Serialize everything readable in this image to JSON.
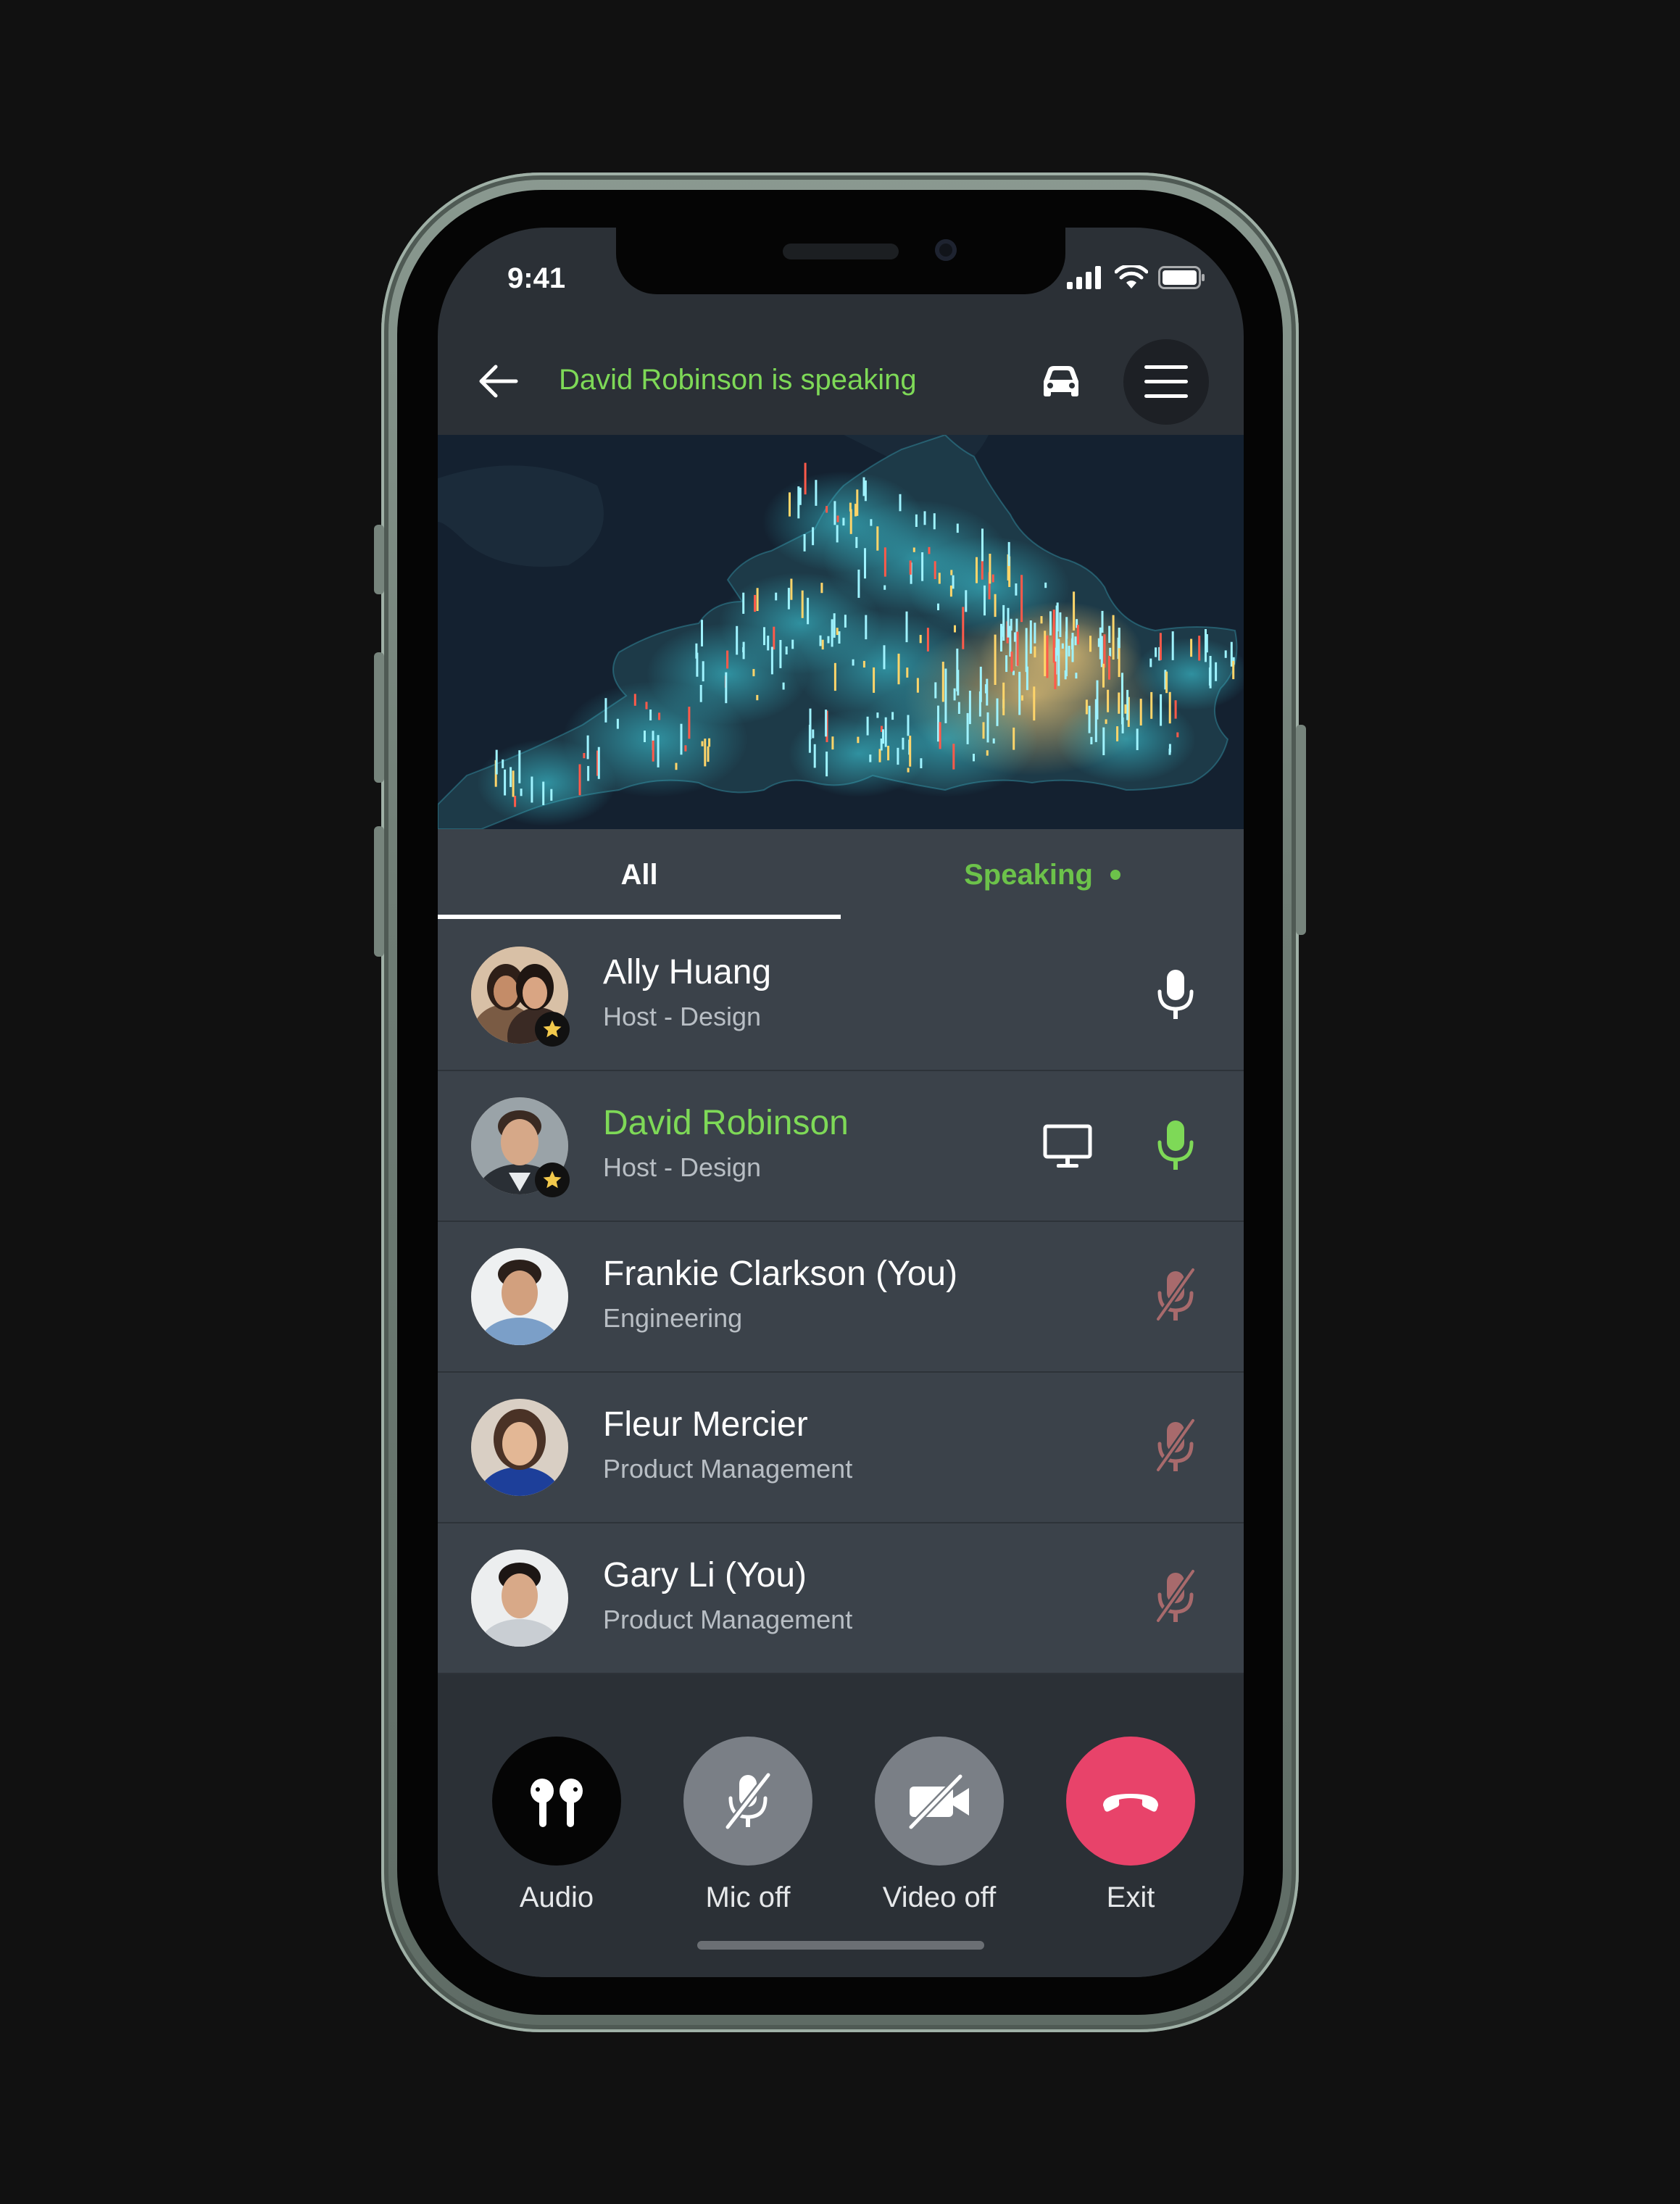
{
  "status_bar": {
    "time": "9:41"
  },
  "header": {
    "title": "David Robinson is speaking"
  },
  "tabs": [
    {
      "label": "All"
    },
    {
      "label": "Speaking"
    }
  ],
  "participants": [
    {
      "name": "Ally Huang",
      "role": "Host - Design",
      "host": true,
      "speaking": false,
      "mic": "on",
      "sharing": false
    },
    {
      "name": "David Robinson",
      "role": "Host - Design",
      "host": true,
      "speaking": true,
      "mic": "active",
      "sharing": true
    },
    {
      "name": "Frankie Clarkson (You)",
      "role": "Engineering",
      "host": false,
      "speaking": false,
      "mic": "muted",
      "sharing": false
    },
    {
      "name": "Fleur Mercier",
      "role": "Product Management",
      "host": false,
      "speaking": false,
      "mic": "muted",
      "sharing": false
    },
    {
      "name": "Gary Li (You)",
      "role": "Product Management",
      "host": false,
      "speaking": false,
      "mic": "muted",
      "sharing": false
    }
  ],
  "controls": {
    "audio": {
      "label": "Audio",
      "icon": "earbuds-icon"
    },
    "mic": {
      "label": "Mic off",
      "icon": "mic-off-icon"
    },
    "video": {
      "label": "Video off",
      "icon": "video-off-icon"
    },
    "exit": {
      "label": "Exit",
      "icon": "hang-up-icon"
    }
  },
  "colors": {
    "speaking_green": "#7ed957",
    "exit_red": "#e8436a",
    "muted_mic": "#a86a6c"
  }
}
